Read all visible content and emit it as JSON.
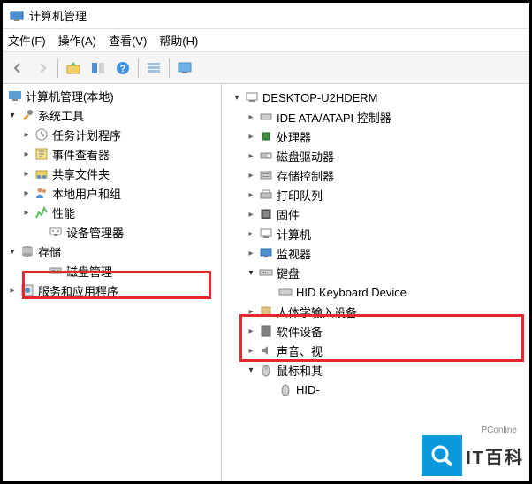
{
  "titlebar": {
    "title": "计算机管理"
  },
  "menubar": {
    "file": "文件(F)",
    "action": "操作(A)",
    "view": "查看(V)",
    "help": "帮助(H)"
  },
  "left_tree": {
    "root": "计算机管理(本地)",
    "system_tools": "系统工具",
    "task_scheduler": "任务计划程序",
    "event_viewer": "事件查看器",
    "shared_folders": "共享文件夹",
    "local_users": "本地用户和组",
    "performance": "性能",
    "device_manager": "设备管理器",
    "storage": "存储",
    "disk_management": "磁盘管理",
    "services_apps": "服务和应用程序"
  },
  "right_tree": {
    "computer": "DESKTOP-U2HDERM",
    "ide": "IDE ATA/ATAPI 控制器",
    "processors": "处理器",
    "disk_drives": "磁盘驱动器",
    "storage_ctrl": "存储控制器",
    "print_queues": "打印队列",
    "firmware": "固件",
    "computers": "计算机",
    "monitors": "监视器",
    "keyboards": "键盘",
    "hid_keyboard": "HID Keyboard Device",
    "hid": "人体学输入设备",
    "software": "软件设备",
    "sound": "声音、视",
    "mouse": "鼠标和其",
    "hid_sub": "HID-"
  },
  "watermark": {
    "small": "PConline",
    "big": "IT百科"
  }
}
